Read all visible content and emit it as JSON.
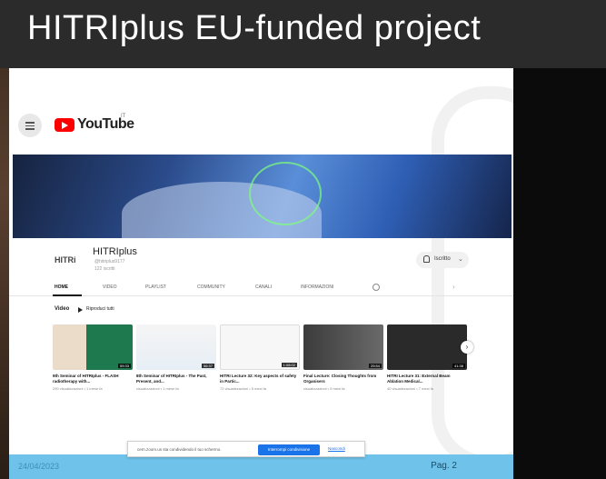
{
  "slide_title": "HITRIplus EU-funded project",
  "youtube": {
    "brand": "YouTube",
    "country": "IT"
  },
  "channel": {
    "logo": "HITRi",
    "name": "HITRIplus",
    "handle": "@hitriplus9177",
    "subscribers": "122 iscritti",
    "subscribe_label": "Iscritto"
  },
  "tabs": [
    "HOME",
    "VIDEO",
    "PLAYLIST",
    "COMMUNITY",
    "CANALI",
    "INFORMAZIONI"
  ],
  "section": {
    "title": "Video",
    "play_all": "Riproduci tutti"
  },
  "videos": [
    {
      "title": "9th Seminar of HITRIplus - FLASH radiotherapy with...",
      "meta": "290 visualizzazioni • 1 mese fa",
      "duration": "59:33"
    },
    {
      "title": "8th Seminar of HITRIplus - The Past, Present, and...",
      "meta": "visualizzazioni • 1 mese fa",
      "duration": "56:37"
    },
    {
      "title": "HITRI Lecture 32: Key aspects of safety in Partic...",
      "meta": "72 visualizzazioni • 5 mesi fa",
      "duration": "1:08:02"
    },
    {
      "title": "Final Lecture: Closing Thoughts from Organisers",
      "meta": "visualizzazioni • 5 mesi fa",
      "duration": "29:54"
    },
    {
      "title": "HITRI Lecture 31: External Beam Ablation Medical...",
      "meta": "40 visualizzazioni • 7 mesi fa",
      "duration": "41:38"
    }
  ],
  "share_bar": {
    "text": "cern.zoom.us sta condividendo il tuo schermo.",
    "stop": "Interrompi condivisione",
    "hide": "Nascondi"
  },
  "footer": {
    "date": "24/04/2023",
    "page": "Pag. 2"
  },
  "colors": {
    "title_bar": "#2b2b2b",
    "footer": "#6fc3ea",
    "youtube_red": "#ff0000",
    "stop_button": "#1a73e8"
  }
}
